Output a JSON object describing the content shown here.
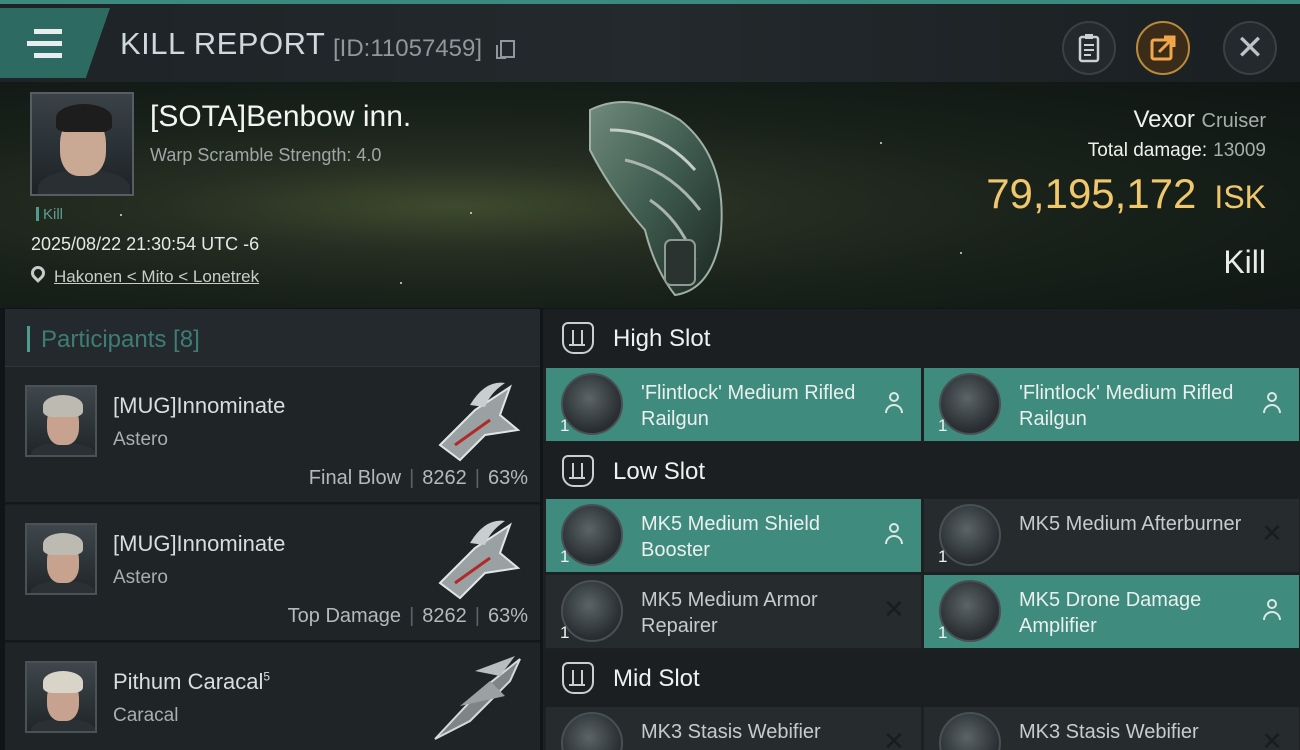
{
  "header": {
    "title": "KILL REPORT",
    "report_id": "[ID:11057459]"
  },
  "victim": {
    "name": "[SOTA]Benbow inn.",
    "subtitle": "Warp Scramble Strength: 4.0",
    "tag": "Kill",
    "datetime": "2025/08/22 21:30:54 UTC -6",
    "location": "Hakonen < Mito < Lonetrek",
    "ship_name": "Vexor",
    "ship_class": "Cruiser",
    "damage_label": "Total damage:",
    "damage_value": "13009",
    "isk_value": "79,195,172",
    "isk_unit": "ISK",
    "result": "Kill"
  },
  "participants": {
    "title": "Participants [8]",
    "rows": [
      {
        "name": "[MUG]Innominate",
        "sup": "",
        "ship": "Astero",
        "role": "Final Blow",
        "damage": "8262",
        "percent": "63%"
      },
      {
        "name": "[MUG]Innominate",
        "sup": "",
        "ship": "Astero",
        "role": "Top Damage",
        "damage": "8262",
        "percent": "63%"
      },
      {
        "name": "Pithum Caracal",
        "sup": "5",
        "ship": "Caracal",
        "role": "",
        "damage": "",
        "percent": ""
      }
    ]
  },
  "fitting": {
    "high_slot": "High Slot",
    "low_slot": "Low Slot",
    "mid_slot": "Mid Slot",
    "modules": [
      {
        "name": "'Flintlock' Medium Rifled Railgun",
        "qty": "1",
        "status": "dropped"
      },
      {
        "name": "'Flintlock' Medium Rifled Railgun",
        "qty": "1",
        "status": "dropped"
      },
      {
        "name": "MK5 Medium Shield Booster",
        "qty": "1",
        "status": "dropped"
      },
      {
        "name": "MK5 Medium Afterburner",
        "qty": "1",
        "status": "destroyed"
      },
      {
        "name": "MK5 Medium Armor Repairer",
        "qty": "1",
        "status": "destroyed"
      },
      {
        "name": "MK5 Drone Damage Amplifier",
        "qty": "1",
        "status": "dropped"
      },
      {
        "name": "MK3 Stasis Webifier",
        "qty": "",
        "status": "destroyed"
      },
      {
        "name": "MK3 Stasis Webifier",
        "qty": "",
        "status": "destroyed"
      }
    ]
  },
  "colors": {
    "accent": "#3f8b7d",
    "isk": "#f0c76d",
    "participants_title": "#3e7d74"
  },
  "icons": [
    "menu-icon",
    "copy-icon",
    "clipboard-icon",
    "share-icon",
    "close-icon",
    "location-pin-icon",
    "slot-icon",
    "person-icon",
    "x-icon"
  ]
}
